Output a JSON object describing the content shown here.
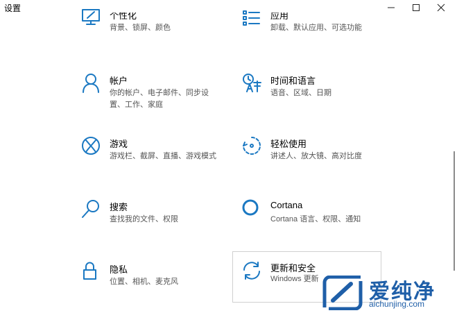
{
  "window": {
    "title": "设置",
    "minimize_icon": "minimize-icon",
    "maximize_icon": "maximize-icon",
    "close_icon": "close-icon"
  },
  "tiles": [
    {
      "name": "个性化",
      "desc": "背景、锁屏、颜色",
      "icon": "personalization-icon"
    },
    {
      "name": "应用",
      "desc": "卸载、默认应用、可选功能",
      "icon": "apps-icon"
    },
    {
      "name": "帐户",
      "desc": "你的帐户、电子邮件、同步设置、工作、家庭",
      "icon": "accounts-icon"
    },
    {
      "name": "时间和语言",
      "desc": "语音、区域、日期",
      "icon": "time-language-icon"
    },
    {
      "name": "游戏",
      "desc": "游戏栏、截屏、直播、游戏模式",
      "icon": "xbox-icon"
    },
    {
      "name": "轻松使用",
      "desc": "讲述人、放大镜、高对比度",
      "icon": "ease-of-access-icon"
    },
    {
      "name": "搜索",
      "desc": "查找我的文件、权限",
      "icon": "search-icon"
    },
    {
      "name": "Cortana",
      "desc": "Cortana 语言、权限、通知",
      "icon": "cortana-icon"
    },
    {
      "name": "隐私",
      "desc": "位置、相机、麦克风",
      "icon": "lock-icon"
    },
    {
      "name": "更新和安全",
      "desc": "Windows 更新",
      "icon": "update-icon"
    }
  ],
  "watermark": {
    "text": "爱纯净",
    "url": "aichunjing.com"
  },
  "colors": {
    "accent": "#1a78c2",
    "watermark": "#1f5fa8"
  }
}
